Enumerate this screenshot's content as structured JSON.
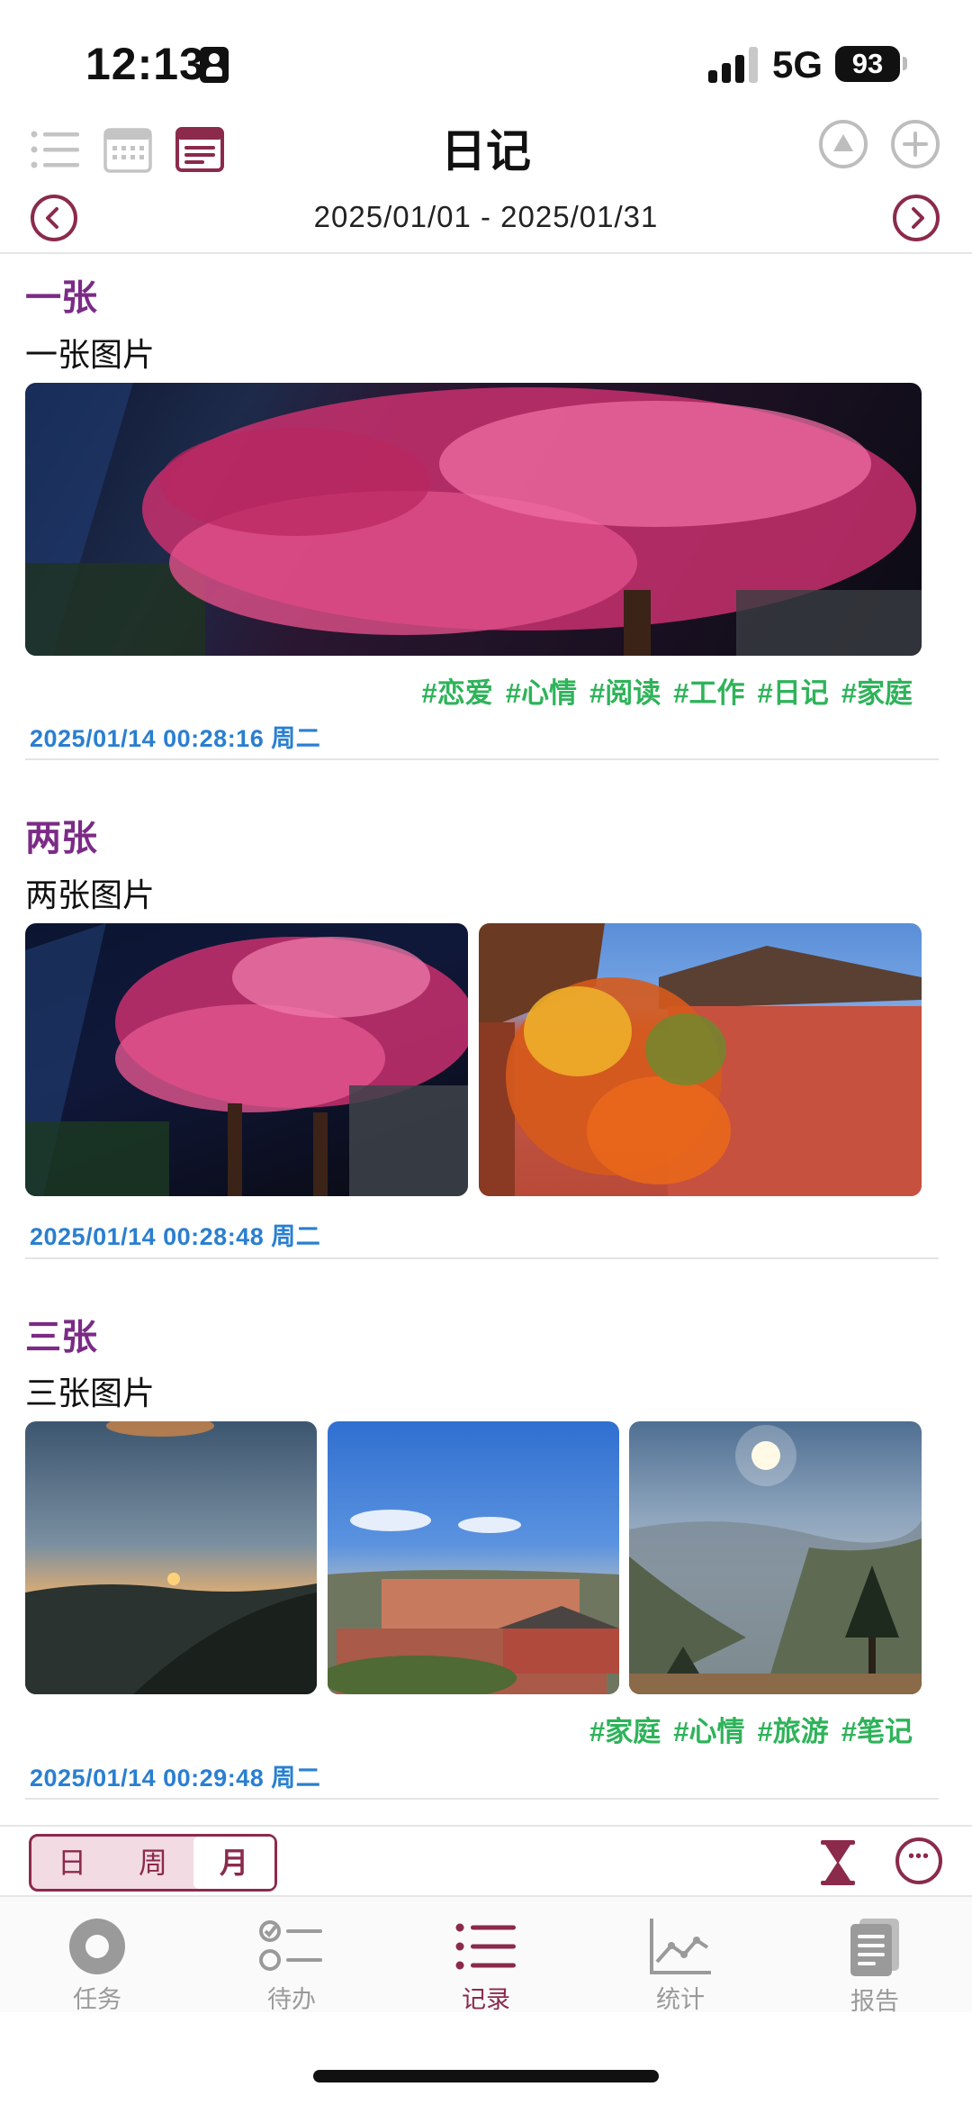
{
  "status_bar": {
    "time": "12:13",
    "network": "5G",
    "battery": "93"
  },
  "header": {
    "title": "日记"
  },
  "date_range": "2025/01/01 - 2025/01/31",
  "entries": [
    {
      "title": "一张",
      "text": "一张图片",
      "tags": [
        "#恋爱",
        "#心情",
        "#阅读",
        "#工作",
        "#日记",
        "#家庭"
      ],
      "timestamp": "2025/01/14 00:28:16 周二"
    },
    {
      "title": "两张",
      "text": "两张图片",
      "tags": [],
      "timestamp": "2025/01/14 00:28:48 周二"
    },
    {
      "title": "三张",
      "text": "三张图片",
      "tags": [
        "#家庭",
        "#心情",
        "#旅游",
        "#笔记"
      ],
      "timestamp": "2025/01/14 00:29:48 周二"
    }
  ],
  "period_selector": {
    "options": [
      "日",
      "周",
      "月"
    ],
    "selected": "月"
  },
  "tabs": [
    {
      "label": "任务",
      "icon": "record-circle-icon"
    },
    {
      "label": "待办",
      "icon": "checklist-icon"
    },
    {
      "label": "记录",
      "icon": "list-icon",
      "active": true
    },
    {
      "label": "统计",
      "icon": "line-chart-icon"
    },
    {
      "label": "报告",
      "icon": "report-document-icon"
    }
  ],
  "colors": {
    "accent": "#8b2a4b",
    "entry_title": "#7b2b86",
    "tag": "#2fb35a",
    "timestamp": "#2a7fd0"
  }
}
